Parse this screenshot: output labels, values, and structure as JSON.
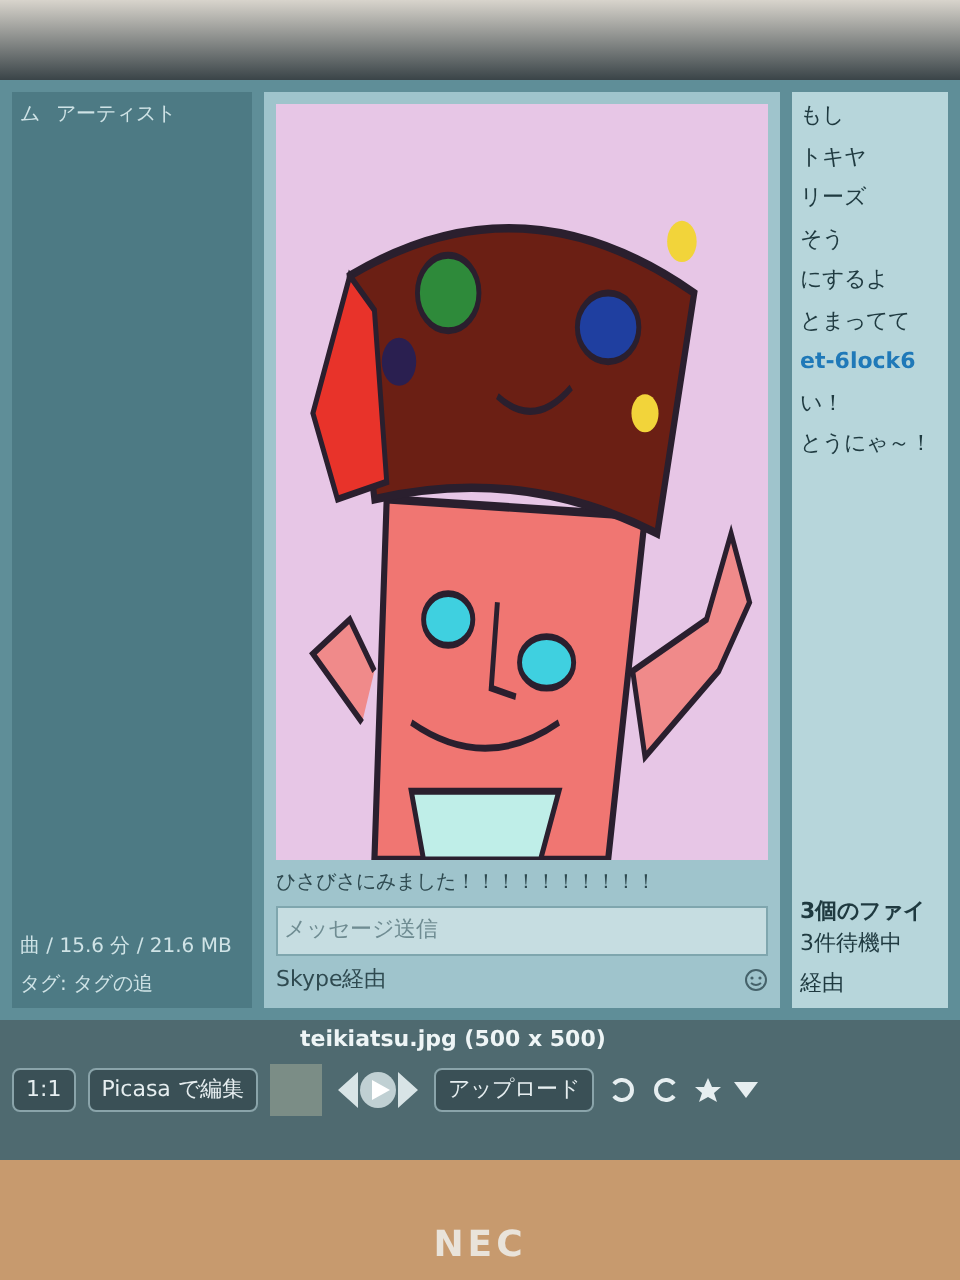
{
  "left_pane": {
    "header": [
      "ム",
      "アーティスト"
    ],
    "summary": "曲 / 15.6 分 / 21.6 MB",
    "tags": "タグ: タグの追"
  },
  "chat": {
    "message": "ひさびさにみました！！！！！！！！！！",
    "input_placeholder": "メッセージ送信",
    "via": "Skype経由"
  },
  "right_pane": {
    "lines": [
      {
        "text": "もし",
        "kind": "plain"
      },
      {
        "text": "トキヤ",
        "kind": "plain"
      },
      {
        "text": "リーズ",
        "kind": "plain"
      },
      {
        "text": "そう",
        "kind": "plain"
      },
      {
        "text": "にするよ",
        "kind": "plain"
      },
      {
        "text": "とまってて",
        "kind": "plain"
      },
      {
        "text": "et-6lock6",
        "kind": "name"
      },
      {
        "text": "い！",
        "kind": "plain"
      },
      {
        "text": "とうにゃ～！",
        "kind": "plain"
      }
    ],
    "transfer": {
      "title": "3個のファイ",
      "status": "3件待機中"
    },
    "via": "経由"
  },
  "viewer": {
    "filename": "teikiatsu.jpg (500 x 500)",
    "zoom": "1:1",
    "edit_button": "Picasa で編集",
    "upload_button": "アップロード"
  },
  "laptop": {
    "brand": "NEC"
  }
}
